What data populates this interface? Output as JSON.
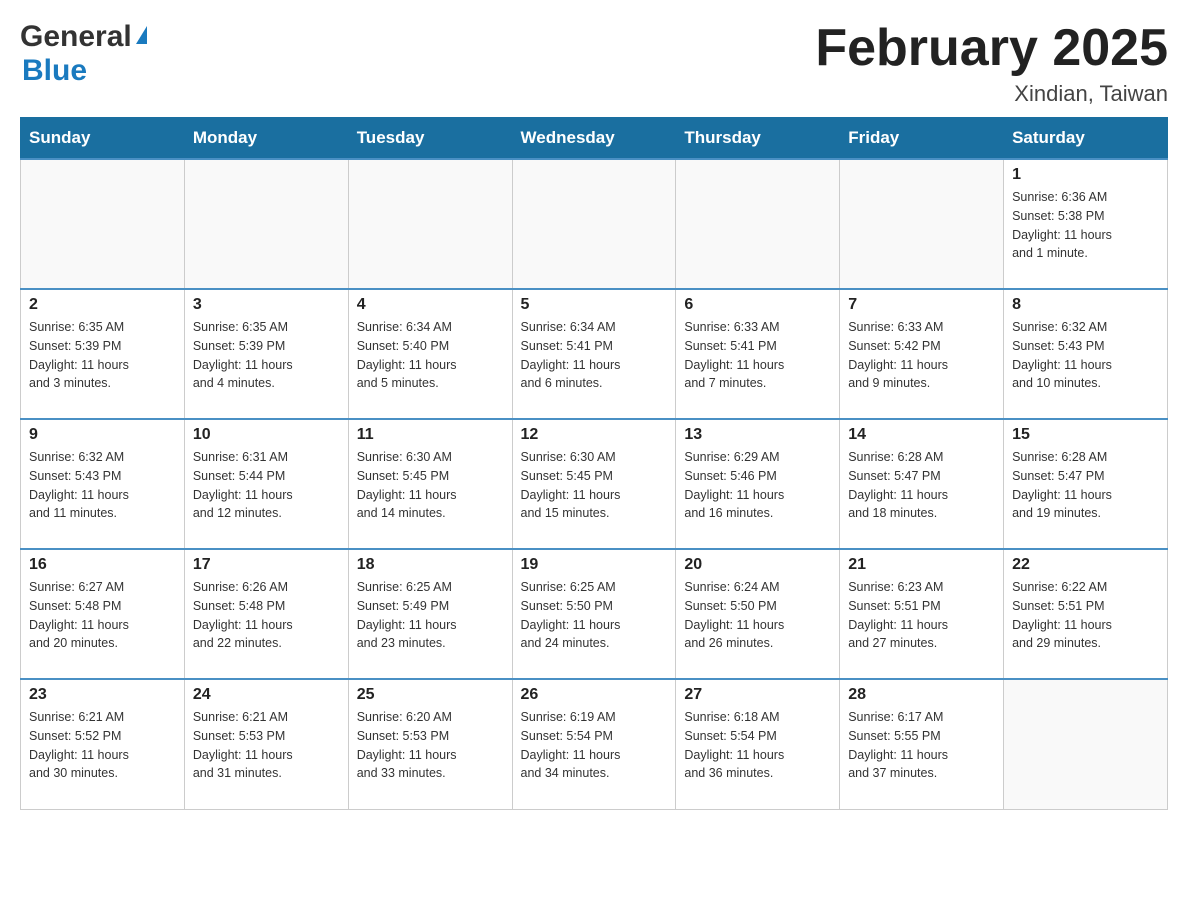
{
  "header": {
    "logo_general": "General",
    "logo_blue": "Blue",
    "month_title": "February 2025",
    "location": "Xindian, Taiwan"
  },
  "weekdays": [
    "Sunday",
    "Monday",
    "Tuesday",
    "Wednesday",
    "Thursday",
    "Friday",
    "Saturday"
  ],
  "weeks": [
    {
      "days": [
        {
          "number": "",
          "info": ""
        },
        {
          "number": "",
          "info": ""
        },
        {
          "number": "",
          "info": ""
        },
        {
          "number": "",
          "info": ""
        },
        {
          "number": "",
          "info": ""
        },
        {
          "number": "",
          "info": ""
        },
        {
          "number": "1",
          "info": "Sunrise: 6:36 AM\nSunset: 5:38 PM\nDaylight: 11 hours\nand 1 minute."
        }
      ]
    },
    {
      "days": [
        {
          "number": "2",
          "info": "Sunrise: 6:35 AM\nSunset: 5:39 PM\nDaylight: 11 hours\nand 3 minutes."
        },
        {
          "number": "3",
          "info": "Sunrise: 6:35 AM\nSunset: 5:39 PM\nDaylight: 11 hours\nand 4 minutes."
        },
        {
          "number": "4",
          "info": "Sunrise: 6:34 AM\nSunset: 5:40 PM\nDaylight: 11 hours\nand 5 minutes."
        },
        {
          "number": "5",
          "info": "Sunrise: 6:34 AM\nSunset: 5:41 PM\nDaylight: 11 hours\nand 6 minutes."
        },
        {
          "number": "6",
          "info": "Sunrise: 6:33 AM\nSunset: 5:41 PM\nDaylight: 11 hours\nand 7 minutes."
        },
        {
          "number": "7",
          "info": "Sunrise: 6:33 AM\nSunset: 5:42 PM\nDaylight: 11 hours\nand 9 minutes."
        },
        {
          "number": "8",
          "info": "Sunrise: 6:32 AM\nSunset: 5:43 PM\nDaylight: 11 hours\nand 10 minutes."
        }
      ]
    },
    {
      "days": [
        {
          "number": "9",
          "info": "Sunrise: 6:32 AM\nSunset: 5:43 PM\nDaylight: 11 hours\nand 11 minutes."
        },
        {
          "number": "10",
          "info": "Sunrise: 6:31 AM\nSunset: 5:44 PM\nDaylight: 11 hours\nand 12 minutes."
        },
        {
          "number": "11",
          "info": "Sunrise: 6:30 AM\nSunset: 5:45 PM\nDaylight: 11 hours\nand 14 minutes."
        },
        {
          "number": "12",
          "info": "Sunrise: 6:30 AM\nSunset: 5:45 PM\nDaylight: 11 hours\nand 15 minutes."
        },
        {
          "number": "13",
          "info": "Sunrise: 6:29 AM\nSunset: 5:46 PM\nDaylight: 11 hours\nand 16 minutes."
        },
        {
          "number": "14",
          "info": "Sunrise: 6:28 AM\nSunset: 5:47 PM\nDaylight: 11 hours\nand 18 minutes."
        },
        {
          "number": "15",
          "info": "Sunrise: 6:28 AM\nSunset: 5:47 PM\nDaylight: 11 hours\nand 19 minutes."
        }
      ]
    },
    {
      "days": [
        {
          "number": "16",
          "info": "Sunrise: 6:27 AM\nSunset: 5:48 PM\nDaylight: 11 hours\nand 20 minutes."
        },
        {
          "number": "17",
          "info": "Sunrise: 6:26 AM\nSunset: 5:48 PM\nDaylight: 11 hours\nand 22 minutes."
        },
        {
          "number": "18",
          "info": "Sunrise: 6:25 AM\nSunset: 5:49 PM\nDaylight: 11 hours\nand 23 minutes."
        },
        {
          "number": "19",
          "info": "Sunrise: 6:25 AM\nSunset: 5:50 PM\nDaylight: 11 hours\nand 24 minutes."
        },
        {
          "number": "20",
          "info": "Sunrise: 6:24 AM\nSunset: 5:50 PM\nDaylight: 11 hours\nand 26 minutes."
        },
        {
          "number": "21",
          "info": "Sunrise: 6:23 AM\nSunset: 5:51 PM\nDaylight: 11 hours\nand 27 minutes."
        },
        {
          "number": "22",
          "info": "Sunrise: 6:22 AM\nSunset: 5:51 PM\nDaylight: 11 hours\nand 29 minutes."
        }
      ]
    },
    {
      "days": [
        {
          "number": "23",
          "info": "Sunrise: 6:21 AM\nSunset: 5:52 PM\nDaylight: 11 hours\nand 30 minutes."
        },
        {
          "number": "24",
          "info": "Sunrise: 6:21 AM\nSunset: 5:53 PM\nDaylight: 11 hours\nand 31 minutes."
        },
        {
          "number": "25",
          "info": "Sunrise: 6:20 AM\nSunset: 5:53 PM\nDaylight: 11 hours\nand 33 minutes."
        },
        {
          "number": "26",
          "info": "Sunrise: 6:19 AM\nSunset: 5:54 PM\nDaylight: 11 hours\nand 34 minutes."
        },
        {
          "number": "27",
          "info": "Sunrise: 6:18 AM\nSunset: 5:54 PM\nDaylight: 11 hours\nand 36 minutes."
        },
        {
          "number": "28",
          "info": "Sunrise: 6:17 AM\nSunset: 5:55 PM\nDaylight: 11 hours\nand 37 minutes."
        },
        {
          "number": "",
          "info": ""
        }
      ]
    }
  ]
}
